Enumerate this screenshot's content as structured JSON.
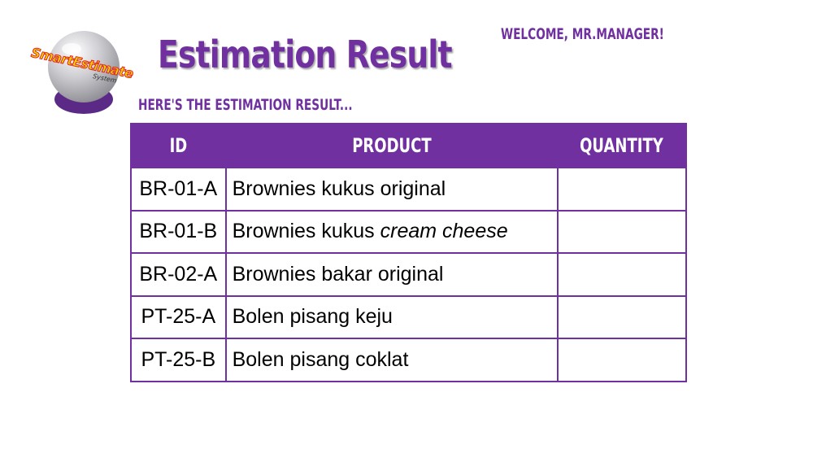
{
  "logo": {
    "text": "SmartEstimate",
    "subtext": "System",
    "colors": {
      "ball": "#c8c8cc",
      "base": "#5b2a86",
      "text": "#ffd700",
      "text_outline": "#e02020"
    }
  },
  "header": {
    "title": "Estimation Result",
    "welcome": "WELCOME, MR.MANAGER!",
    "subtitle": "HERE'S THE ESTIMATION RESULT..."
  },
  "table": {
    "columns": [
      "ID",
      "PRODUCT",
      "QUANTITY"
    ],
    "rows": [
      {
        "id": "BR-01-A",
        "product": "Brownies kukus original",
        "product_italic": "",
        "quantity": ""
      },
      {
        "id": "BR-01-B",
        "product": "Brownies kukus ",
        "product_italic": "cream cheese",
        "quantity": ""
      },
      {
        "id": "BR-02-A",
        "product": "Brownies bakar original",
        "product_italic": "",
        "quantity": ""
      },
      {
        "id": "PT-25-A",
        "product": "Bolen pisang keju",
        "product_italic": "",
        "quantity": ""
      },
      {
        "id": "PT-25-B",
        "product": "Bolen pisang coklat",
        "product_italic": "",
        "quantity": ""
      }
    ]
  },
  "theme": {
    "accent": "#7030a0",
    "header_text": "#ffffff"
  }
}
